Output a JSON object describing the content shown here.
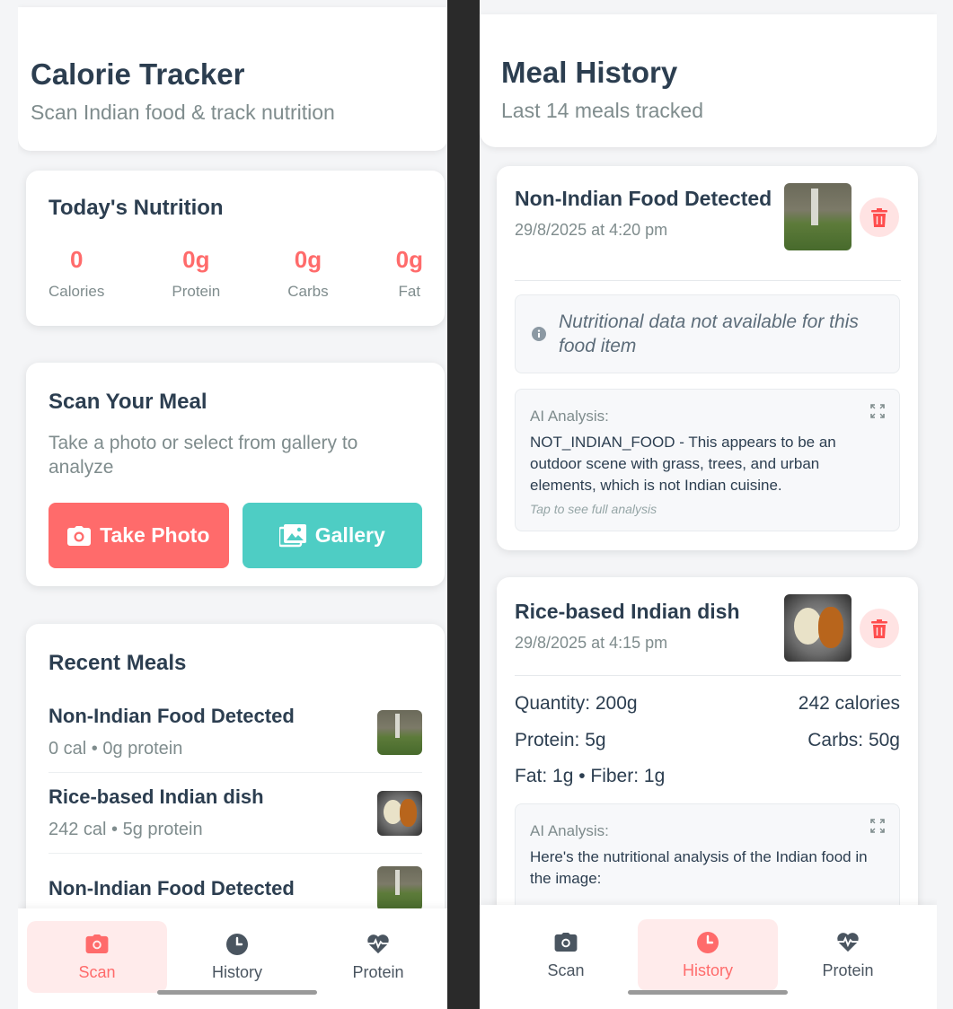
{
  "left": {
    "header": {
      "title": "Calorie Tracker",
      "subtitle": "Scan Indian food & track nutrition"
    },
    "today": {
      "title": "Today's Nutrition",
      "stats": [
        {
          "value": "0",
          "label": "Calories"
        },
        {
          "value": "0g",
          "label": "Protein"
        },
        {
          "value": "0g",
          "label": "Carbs"
        },
        {
          "value": "0g",
          "label": "Fat"
        }
      ]
    },
    "scan": {
      "title": "Scan Your Meal",
      "subtitle": "Take a photo or select from gallery to analyze",
      "take_photo": "Take Photo",
      "gallery": "Gallery"
    },
    "recent": {
      "title": "Recent Meals",
      "items": [
        {
          "name": "Non-Indian Food Detected",
          "meta": "0 cal • 0g protein",
          "thumb": "grass-photo"
        },
        {
          "name": "Rice-based Indian dish",
          "meta": "242 cal • 5g protein",
          "thumb": "food-photo"
        },
        {
          "name": "Non-Indian Food Detected",
          "meta": "",
          "thumb": "grass-photo"
        }
      ]
    },
    "tabs": [
      {
        "label": "Scan",
        "icon": "camera-icon",
        "active": true
      },
      {
        "label": "History",
        "icon": "clock-icon",
        "active": false
      },
      {
        "label": "Protein",
        "icon": "heart-pulse-icon",
        "active": false
      }
    ]
  },
  "right": {
    "header": {
      "title": "Meal History",
      "subtitle": "Last 14 meals tracked"
    },
    "meals": [
      {
        "title": "Non-Indian Food Detected",
        "date": "29/8/2025 at 4:20 pm",
        "na_text": "Nutritional data not available for this food item",
        "ai_label": "AI Analysis:",
        "ai_text": "NOT_INDIAN_FOOD - This appears to be an outdoor scene with grass, trees, and urban elements, which is not Indian cuisine.",
        "ai_hint": "Tap to see full analysis"
      },
      {
        "title": "Rice-based Indian dish",
        "date": "29/8/2025 at 4:15 pm",
        "quantity": "Quantity: 200g",
        "calories": "242 calories",
        "protein": "Protein: 5g",
        "carbs": "Carbs: 50g",
        "fat_fiber": "Fat: 1g • Fiber: 1g",
        "ai_label": "AI Analysis:",
        "ai_text": "Here's the nutritional analysis of the Indian food in the image:"
      }
    ],
    "tabs": [
      {
        "label": "Scan",
        "icon": "camera-icon",
        "active": false
      },
      {
        "label": "History",
        "icon": "clock-icon",
        "active": true
      },
      {
        "label": "Protein",
        "icon": "heart-pulse-icon",
        "active": false
      }
    ]
  },
  "colors": {
    "accent": "#ff6b6b",
    "teal": "#4ecdc4",
    "text": "#2c3e50",
    "muted": "#7f8c8d"
  }
}
